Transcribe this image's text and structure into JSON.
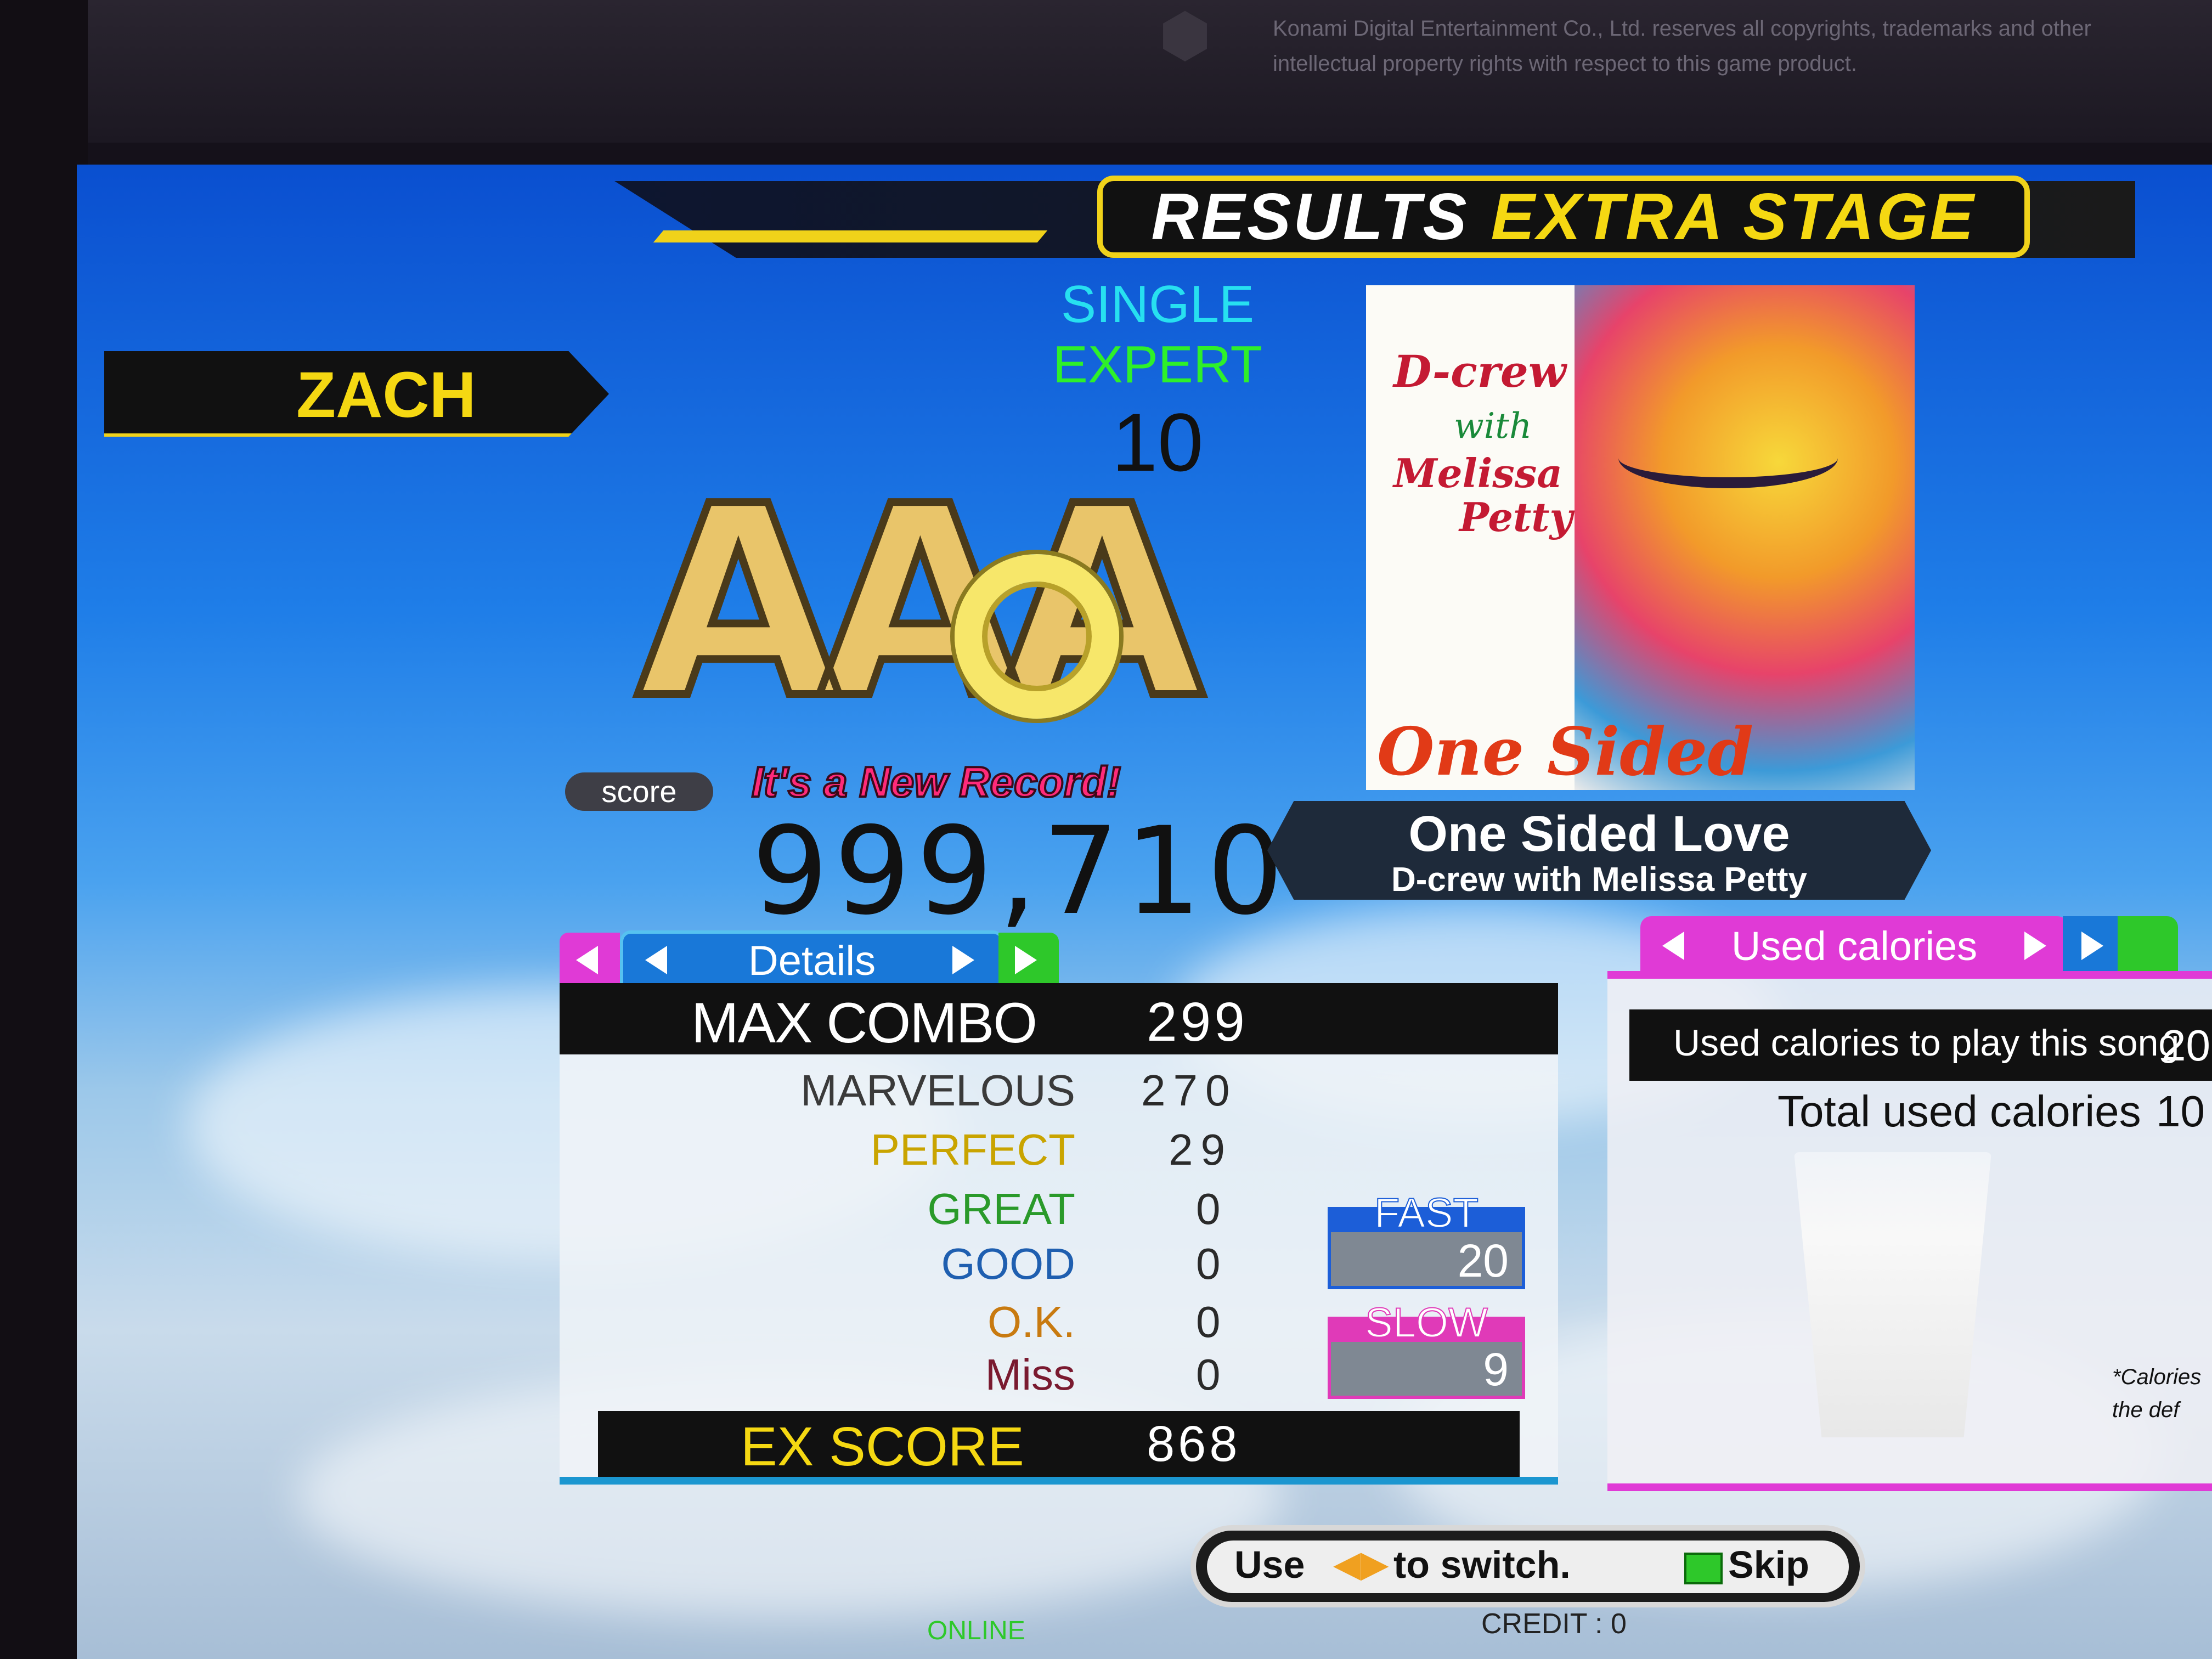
{
  "copyright": "Konami Digital Entertainment Co., Ltd. reserves all copyrights, trademarks and other intellectual property rights with respect to this game product.",
  "header": {
    "results_label": "RESULTS",
    "stage_label": "EXTRA STAGE"
  },
  "player": {
    "name": "ZACH"
  },
  "chart": {
    "play_mode": "SINGLE",
    "difficulty": "EXPERT",
    "level": "10"
  },
  "grade": {
    "letters": "AAA",
    "full_combo": true
  },
  "score": {
    "label": "score",
    "new_record": "It's a New Record!",
    "value": "999,710"
  },
  "song": {
    "title": "One Sided Love",
    "artist": "D-crew with Melissa Petty",
    "jacket": {
      "line1": "D-crew",
      "line2": "with",
      "line3": "Melissa",
      "line4": "Petty",
      "title": "One Sided Love"
    }
  },
  "details": {
    "tab_label": "Details",
    "max_combo": {
      "label": "MAX COMBO",
      "value": "299"
    },
    "judgments": [
      {
        "label": "MARVELOUS",
        "value": "270",
        "color": "#3a3a3a"
      },
      {
        "label": "PERFECT",
        "value": "29",
        "color": "#c9a400"
      },
      {
        "label": "GREAT",
        "value": "0",
        "color": "#2a9a2a"
      },
      {
        "label": "GOOD",
        "value": "0",
        "color": "#1f5fb0"
      },
      {
        "label": "O.K.",
        "value": "0",
        "color": "#c87a10"
      },
      {
        "label": "Miss",
        "value": "0",
        "color": "#7a1a30"
      }
    ],
    "ex_score": {
      "label": "EX SCORE",
      "value": "868"
    },
    "fast": {
      "label": "FAST",
      "value": "20"
    },
    "slow": {
      "label": "SLOW",
      "value": "9"
    }
  },
  "calories": {
    "tab_label": "Used calories",
    "song_label": "Used calories to play this song",
    "song_value": "20",
    "total_label": "Total used calories",
    "total_value": "10",
    "note": "*Calories the def"
  },
  "footer": {
    "use": "Use",
    "switch": "to switch.",
    "skip": "Skip",
    "credit": "CREDIT : 0",
    "online": "ONLINE"
  },
  "colors": {
    "accent_yellow": "#f5d812",
    "panel_blue": "#1978d8",
    "panel_pink": "#e03ad6",
    "panel_green": "#2ec82a"
  }
}
